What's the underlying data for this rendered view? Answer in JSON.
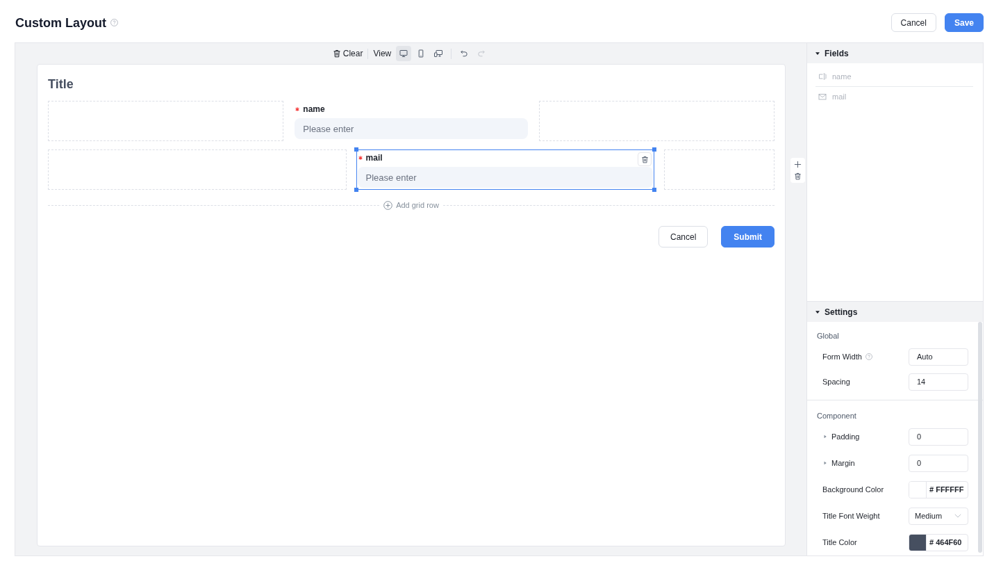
{
  "header": {
    "title": "Custom Layout",
    "buttons": [
      {
        "label": "Cancel",
        "kind": "secondary"
      },
      {
        "label": "Save",
        "kind": "primary"
      }
    ]
  },
  "toolbar": {
    "clear": "Clear",
    "view_label": "View",
    "view_modes": [
      {
        "kind": "desktop",
        "selected": true
      },
      {
        "kind": "mobile",
        "selected": false
      },
      {
        "kind": "responsive",
        "selected": false
      }
    ],
    "undo": {
      "disabled": false
    },
    "redo": {
      "disabled": true
    }
  },
  "form": {
    "title": "Title",
    "rows": [
      {
        "cells": [
          {
            "kind": "empty"
          },
          {
            "kind": "field",
            "label": "name",
            "required": true,
            "placeholder": "Please enter",
            "selected": false
          },
          {
            "kind": "empty"
          }
        ]
      },
      {
        "cells": [
          {
            "kind": "empty"
          },
          {
            "kind": "field",
            "label": "mail",
            "required": true,
            "placeholder": "Please enter",
            "selected": true
          },
          {
            "kind": "empty"
          }
        ]
      }
    ],
    "add_row": "Add grid row",
    "buttons": [
      {
        "label": "Cancel",
        "kind": "secondary"
      },
      {
        "label": "Submit",
        "kind": "primary"
      }
    ]
  },
  "fields_panel": {
    "title": "Fields",
    "expanded": true,
    "items": [
      {
        "label": "name",
        "kind": "text",
        "disabled": true
      },
      {
        "label": "mail",
        "kind": "email",
        "disabled": true
      }
    ]
  },
  "settings_panel": {
    "title": "Settings",
    "expanded": true,
    "groups": [
      {
        "title": "Global",
        "items": [
          {
            "label": "Form Width",
            "kind": "input",
            "value": "Auto",
            "help": true
          },
          {
            "label": "Spacing",
            "kind": "input",
            "value": "14"
          }
        ]
      },
      {
        "title": "Component",
        "items": [
          {
            "label": "Padding",
            "kind": "input",
            "value": "0",
            "expanded": false
          },
          {
            "label": "Margin",
            "kind": "input",
            "value": "0",
            "expanded": false
          },
          {
            "label": "Background Color",
            "kind": "color",
            "value": "# FFFFFF",
            "color": "#ffffff"
          },
          {
            "label": "Title Font Weight",
            "kind": "select",
            "value": "Medium"
          },
          {
            "label": "Title Color",
            "kind": "color",
            "value": "# 464F60",
            "color": "#464f60"
          }
        ]
      }
    ]
  }
}
